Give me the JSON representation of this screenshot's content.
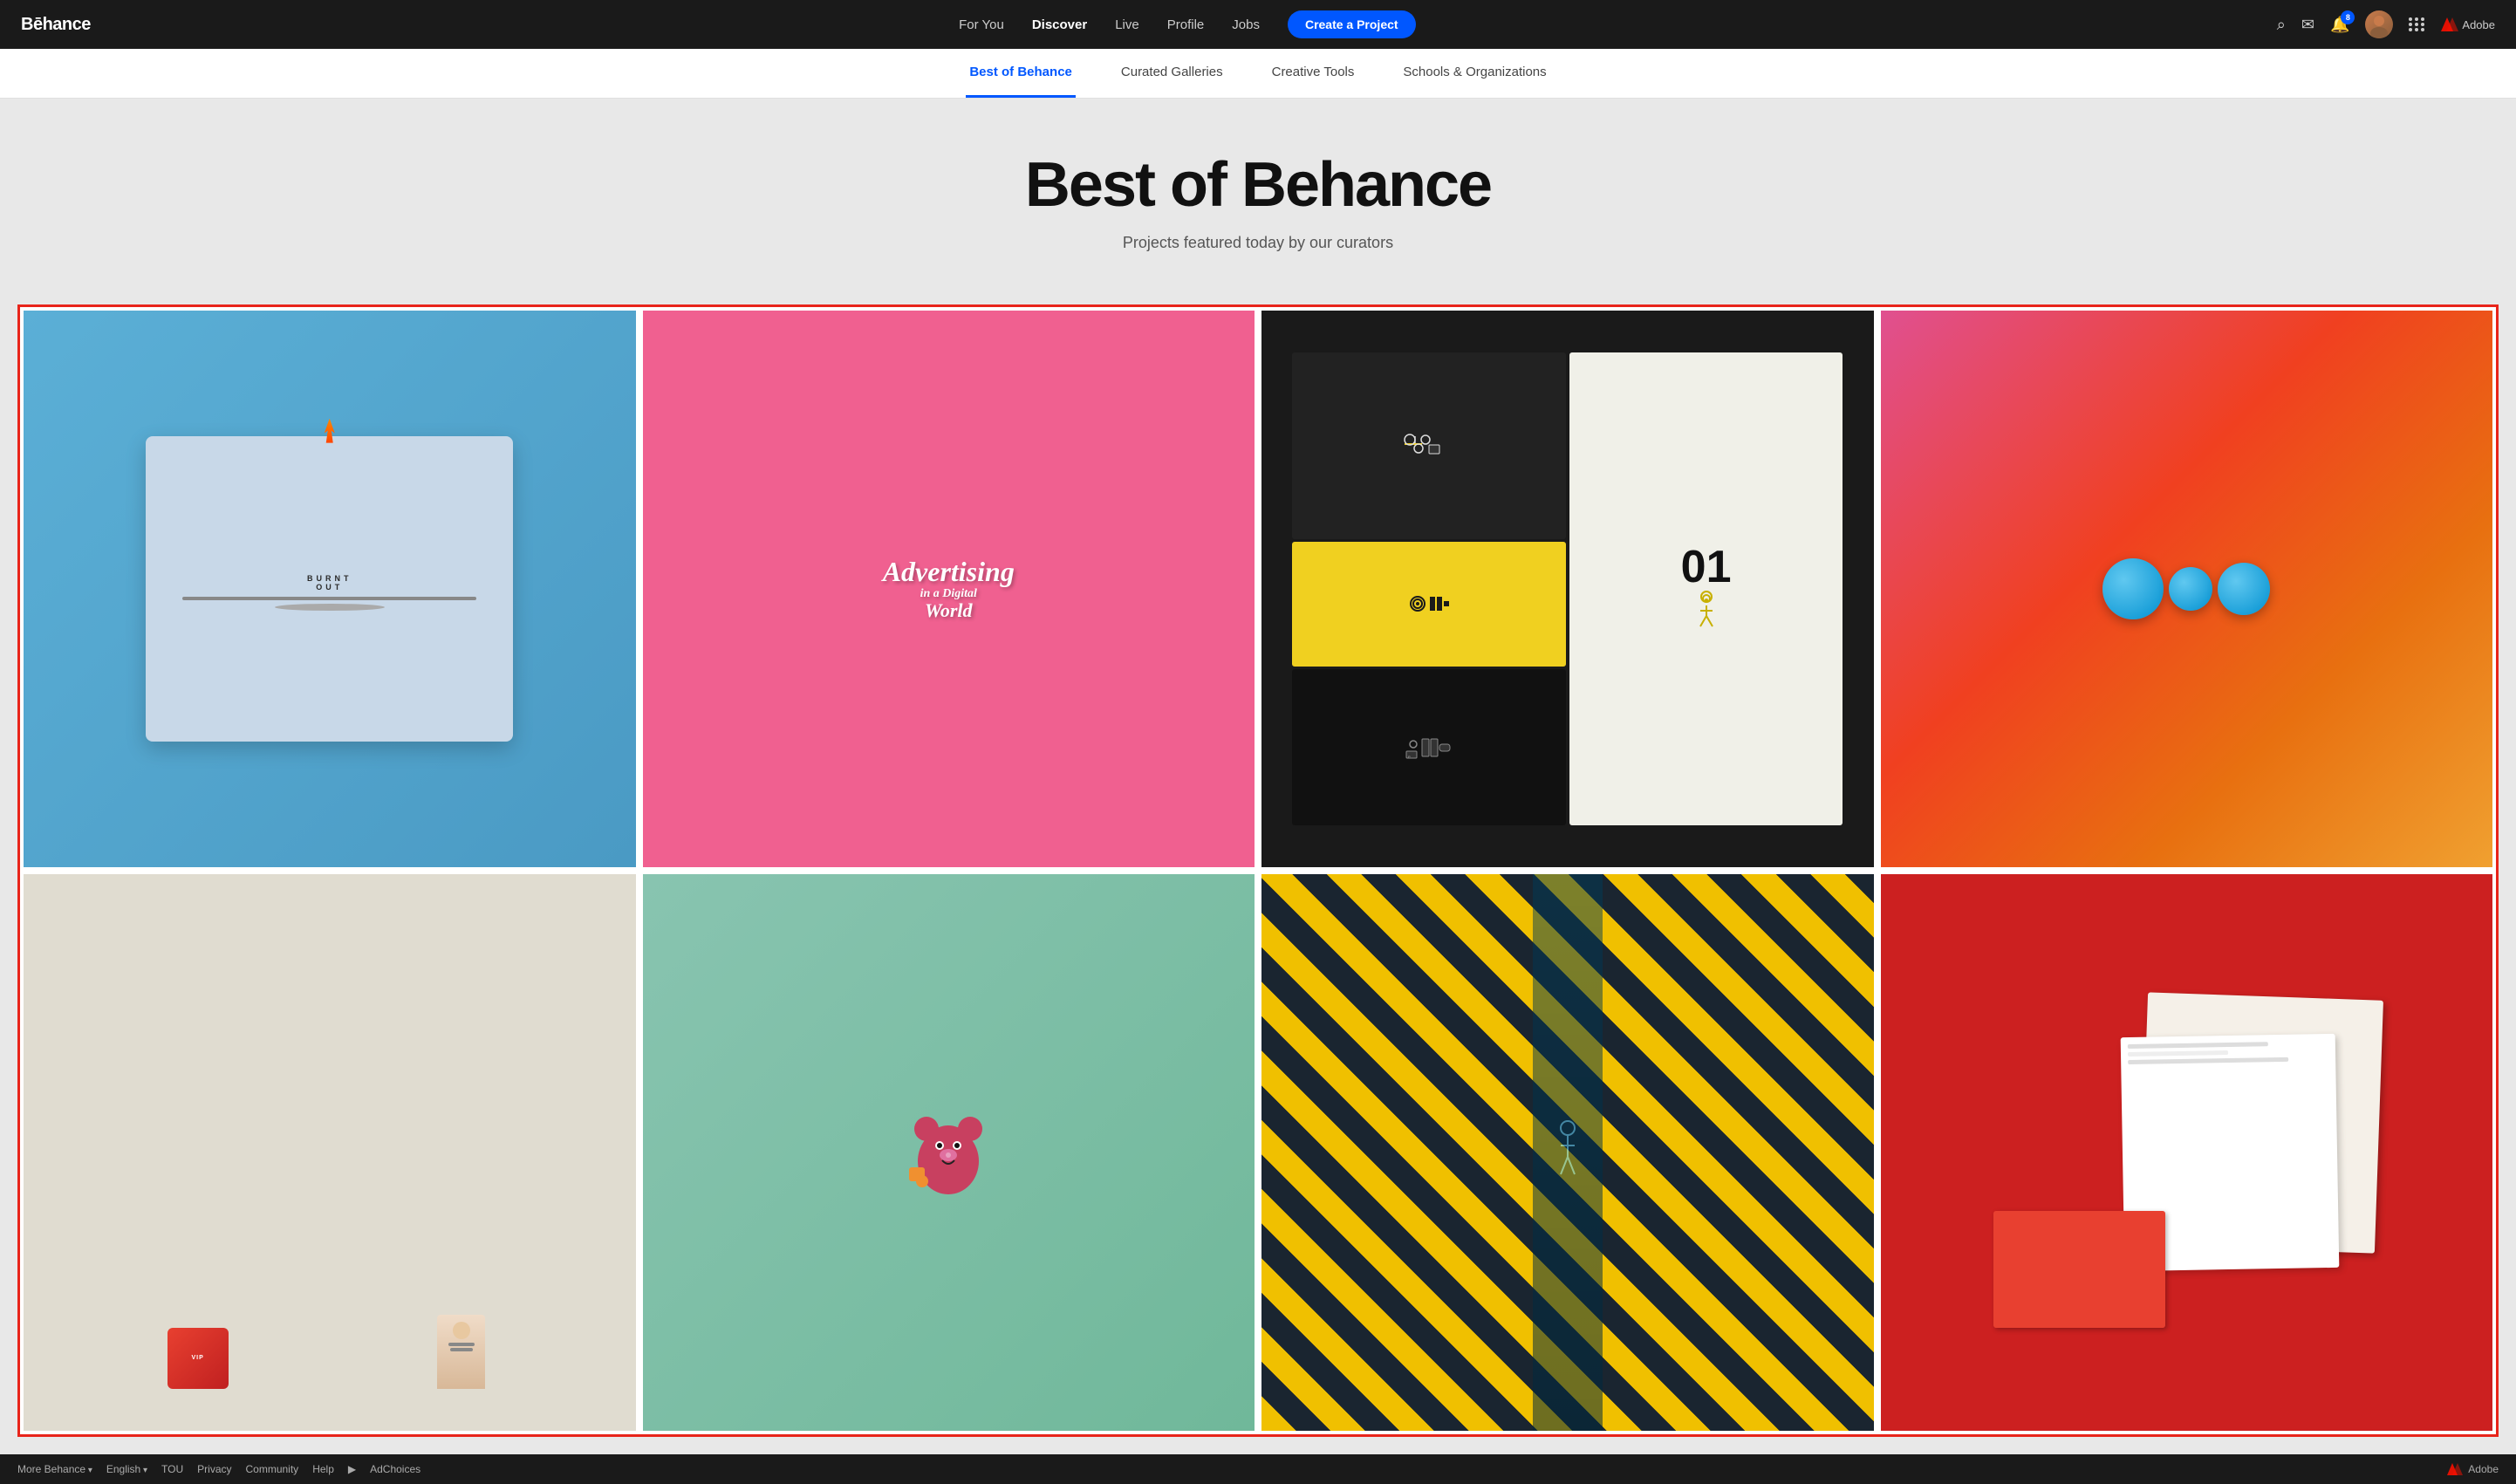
{
  "brand": {
    "logo": "Bēhance"
  },
  "navbar": {
    "links": [
      {
        "label": "For You",
        "active": false
      },
      {
        "label": "Discover",
        "active": true
      },
      {
        "label": "Live",
        "active": false
      },
      {
        "label": "Profile",
        "active": false
      },
      {
        "label": "Jobs",
        "active": false
      }
    ],
    "cta_label": "Create a Project",
    "notification_count": "8"
  },
  "sub_nav": {
    "items": [
      {
        "label": "Best of Behance",
        "active": true
      },
      {
        "label": "Curated Galleries",
        "active": false
      },
      {
        "label": "Creative Tools",
        "active": false
      },
      {
        "label": "Schools & Organizations",
        "active": false
      }
    ]
  },
  "hero": {
    "title": "Best of Behance",
    "subtitle": "Projects featured today by our curators"
  },
  "gallery": {
    "cards": [
      {
        "id": "card-1",
        "alt": "Burnt Out toaster artwork"
      },
      {
        "id": "card-2",
        "alt": "Advertising in a Digital World illustration"
      },
      {
        "id": "card-3",
        "alt": "Design system infographic"
      },
      {
        "id": "card-4",
        "alt": "Blue spheres on colorful background"
      },
      {
        "id": "card-5",
        "alt": "VIP box with person"
      },
      {
        "id": "card-6",
        "alt": "Cartoon bear character"
      },
      {
        "id": "card-7",
        "alt": "Yellow diagonal stripes pattern"
      },
      {
        "id": "card-8",
        "alt": "Red background with paper cards"
      }
    ]
  },
  "footer": {
    "links": [
      {
        "label": "More Behance",
        "dropdown": true
      },
      {
        "label": "English",
        "dropdown": true
      },
      {
        "label": "TOU"
      },
      {
        "label": "Privacy"
      },
      {
        "label": "Community"
      },
      {
        "label": "Help"
      },
      {
        "label": "AdChoices"
      }
    ],
    "adobe_label": "Adobe"
  }
}
